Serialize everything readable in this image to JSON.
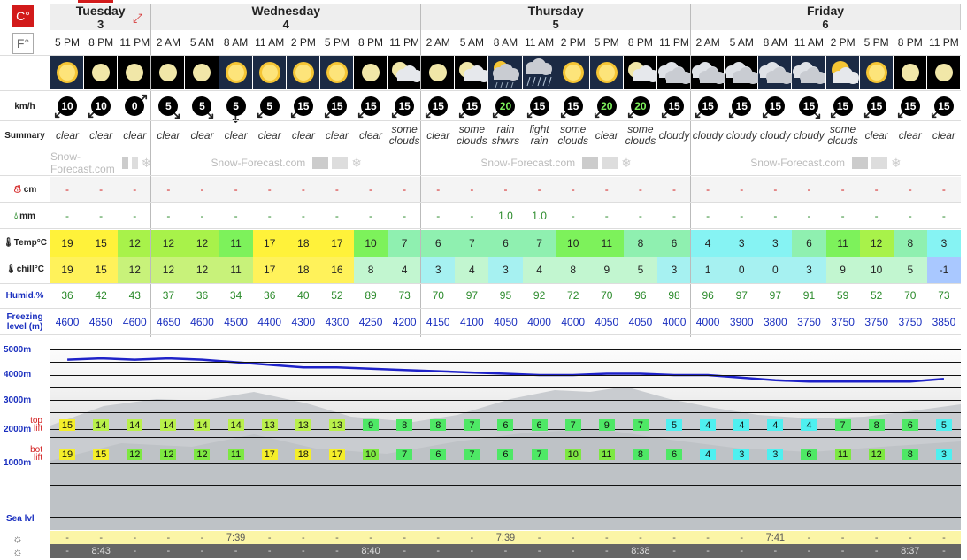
{
  "units": {
    "celsius": "C°",
    "fahrenheit": "F°"
  },
  "days": [
    {
      "name": "Tuesday",
      "date": "3"
    },
    {
      "name": "Wednesday",
      "date": "4"
    },
    {
      "name": "Thursday",
      "date": "5"
    },
    {
      "name": "Friday",
      "date": "6"
    }
  ],
  "row_labels": {
    "wind": "km/h",
    "summary": "Summary",
    "snow": "cm",
    "rain": "mm",
    "temp": "Temp°C",
    "chill": "chill°C",
    "humid": "Humid.%",
    "freezing": "Freezing level (m)",
    "top_lift": "top lift",
    "bot_lift": "bot lift",
    "sea_level": "Sea lvl"
  },
  "altitudes": [
    "5000m",
    "4000m",
    "3000m",
    "2000m",
    "1000m"
  ],
  "brand": "Snow-Forecast.com",
  "times": [
    "5 PM",
    "8 PM",
    "11 PM",
    "2 AM",
    "5 AM",
    "8 AM",
    "11 AM",
    "2 PM",
    "5 PM",
    "8 PM",
    "11 PM",
    "2 AM",
    "5 AM",
    "8 AM",
    "11 AM",
    "2 PM",
    "5 PM",
    "8 PM",
    "11 PM",
    "2 AM",
    "5 AM",
    "8 AM",
    "11 AM",
    "2 PM",
    "5 PM",
    "8 PM",
    "11 PM"
  ],
  "weather_icons": [
    "clear-day",
    "clear-night",
    "clear-night",
    "clear-night",
    "clear-night",
    "sunny",
    "sunny",
    "sunny",
    "sunny",
    "clear-night",
    "some-clouds-night",
    "clear-night",
    "some-clouds-night",
    "rain-showers",
    "light-rain",
    "sunny",
    "sunny",
    "some-clouds-night",
    "cloudy-night",
    "cloudy-night",
    "cloudy-night",
    "cloudy",
    "cloudy",
    "some-clouds",
    "sunny",
    "clear-night",
    "clear-night"
  ],
  "wind_speed": [
    "10",
    "10",
    "0",
    "5",
    "5",
    "5",
    "5",
    "15",
    "15",
    "15",
    "15",
    "15",
    "15",
    "20",
    "15",
    "15",
    "20",
    "20",
    "15",
    "15",
    "15",
    "15",
    "15",
    "15",
    "15",
    "15",
    "15"
  ],
  "wind_direction_deg": [
    135,
    135,
    315,
    45,
    45,
    90,
    135,
    135,
    135,
    135,
    135,
    135,
    135,
    135,
    135,
    135,
    135,
    135,
    135,
    135,
    135,
    135,
    45,
    135,
    135,
    135,
    135
  ],
  "summary": [
    "clear",
    "clear",
    "clear",
    "clear",
    "clear",
    "clear",
    "clear",
    "clear",
    "clear",
    "clear",
    "some clouds",
    "clear",
    "some clouds",
    "rain shwrs",
    "light rain",
    "some clouds",
    "clear",
    "some clouds",
    "cloudy",
    "cloudy",
    "cloudy",
    "cloudy",
    "cloudy",
    "some clouds",
    "clear",
    "clear",
    "clear"
  ],
  "snow_cm": [
    "-",
    "-",
    "-",
    "-",
    "-",
    "-",
    "-",
    "-",
    "-",
    "-",
    "-",
    "-",
    "-",
    "-",
    "-",
    "-",
    "-",
    "-",
    "-",
    "-",
    "-",
    "-",
    "-",
    "-",
    "-",
    "-",
    "-"
  ],
  "rain_mm": [
    "-",
    "-",
    "-",
    "-",
    "-",
    "-",
    "-",
    "-",
    "-",
    "-",
    "-",
    "-",
    "-",
    "1.0",
    "1.0",
    "-",
    "-",
    "-",
    "-",
    "-",
    "-",
    "-",
    "-",
    "-",
    "-",
    "-",
    "-"
  ],
  "temp": [
    "19",
    "15",
    "12",
    "12",
    "12",
    "11",
    "17",
    "18",
    "17",
    "10",
    "7",
    "6",
    "7",
    "6",
    "7",
    "10",
    "11",
    "8",
    "6",
    "4",
    "3",
    "3",
    "6",
    "11",
    "12",
    "8",
    "3"
  ],
  "chill": [
    "19",
    "15",
    "12",
    "12",
    "12",
    "11",
    "17",
    "18",
    "16",
    "8",
    "4",
    "3",
    "4",
    "3",
    "4",
    "8",
    "9",
    "5",
    "3",
    "1",
    "0",
    "0",
    "3",
    "9",
    "10",
    "5",
    "-1"
  ],
  "humidity": [
    "36",
    "42",
    "43",
    "37",
    "36",
    "34",
    "36",
    "40",
    "52",
    "89",
    "73",
    "70",
    "97",
    "95",
    "92",
    "72",
    "70",
    "96",
    "98",
    "96",
    "97",
    "97",
    "91",
    "59",
    "52",
    "70",
    "73"
  ],
  "freezing_level": [
    "4600",
    "4650",
    "4600",
    "4650",
    "4600",
    "4500",
    "4400",
    "4300",
    "4300",
    "4250",
    "4200",
    "4150",
    "4100",
    "4050",
    "4000",
    "4000",
    "4050",
    "4050",
    "4000",
    "4000",
    "3900",
    "3800",
    "3750",
    "3750",
    "3750",
    "3750",
    "3850"
  ],
  "top_lift": [
    "15",
    "14",
    "14",
    "14",
    "14",
    "14",
    "13",
    "13",
    "13",
    "9",
    "8",
    "8",
    "7",
    "6",
    "6",
    "7",
    "9",
    "7",
    "5",
    "4",
    "4",
    "4",
    "4",
    "7",
    "8",
    "6",
    "5"
  ],
  "bot_lift": [
    "19",
    "15",
    "12",
    "12",
    "12",
    "11",
    "17",
    "18",
    "17",
    "10",
    "7",
    "6",
    "7",
    "6",
    "7",
    "10",
    "11",
    "8",
    "6",
    "4",
    "3",
    "3",
    "6",
    "11",
    "12",
    "8",
    "3"
  ],
  "sunrise": [
    "",
    "",
    "",
    "",
    "",
    "7:39",
    "",
    "",
    "",
    "",
    "",
    "",
    "",
    "7:39",
    "",
    "",
    "",
    "",
    "",
    "",
    "",
    "7:41",
    "",
    "",
    "",
    "",
    ""
  ],
  "sunset": [
    "",
    "8:43",
    "",
    "",
    "",
    "",
    "",
    "",
    "",
    "8:40",
    "",
    "",
    "",
    "",
    "",
    "",
    "",
    "8:38",
    "",
    "",
    "",
    "",
    "",
    "",
    "",
    "8:37",
    ""
  ],
  "colors": {
    "accent": "#d21a1a",
    "freezing_line": "#1e22c8",
    "altitude_label": "#1a2fbf"
  }
}
